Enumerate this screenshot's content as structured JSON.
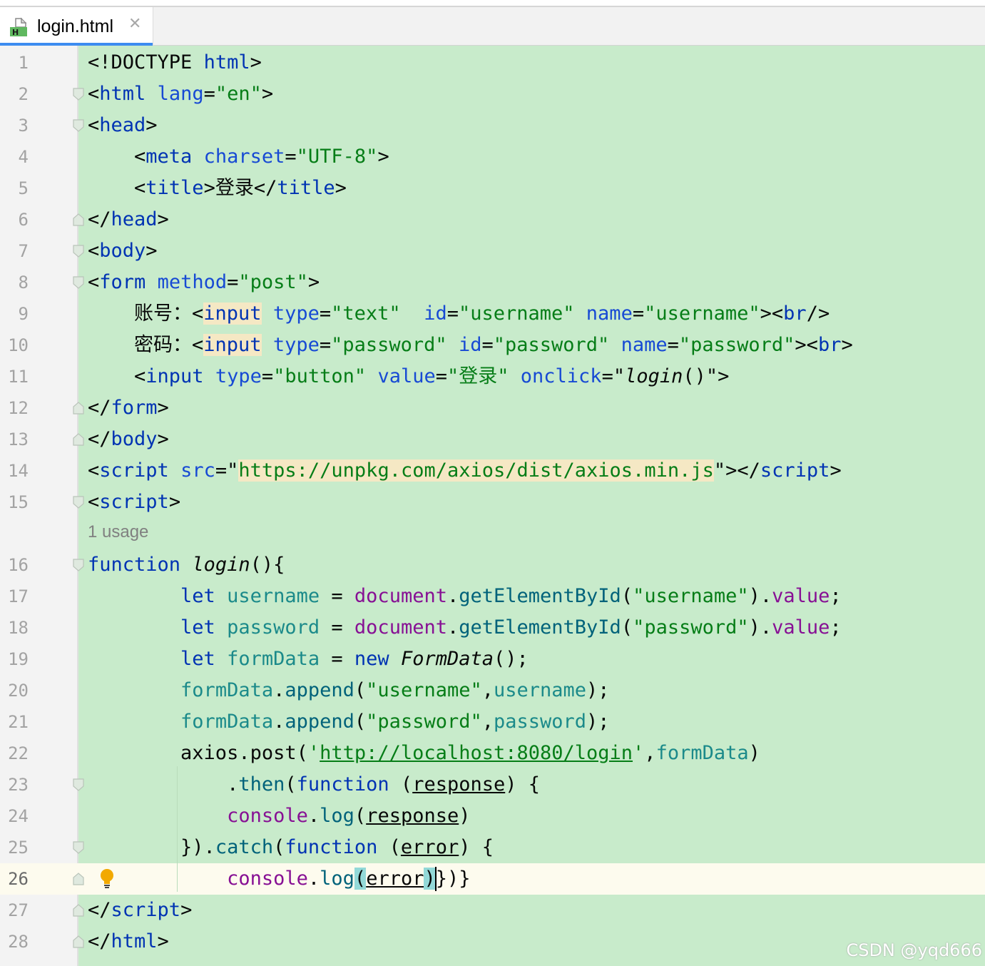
{
  "tab": {
    "label": "login.html",
    "icon": "html-file-icon",
    "close_icon": "close-icon",
    "close_glyph": "✕"
  },
  "editor": {
    "line_numbers": [
      "1",
      "2",
      "3",
      "4",
      "5",
      "6",
      "7",
      "8",
      "9",
      "10",
      "11",
      "12",
      "13",
      "14",
      "15",
      "16",
      "17",
      "18",
      "19",
      "20",
      "21",
      "22",
      "23",
      "24",
      "25",
      "26",
      "27",
      "28"
    ],
    "usage_hint": "1 usage",
    "current_line": "26",
    "intention_icon": "lightbulb-icon",
    "lines": [
      [
        {
          "t": "<!DOCTYPE "
        },
        {
          "t": "html",
          "c": "tag"
        },
        {
          "t": ">"
        }
      ],
      [
        {
          "t": "<"
        },
        {
          "t": "html",
          "c": "tag"
        },
        {
          "t": " "
        },
        {
          "t": "lang",
          "c": "attr"
        },
        {
          "t": "="
        },
        {
          "t": "\"en\"",
          "c": "str"
        },
        {
          "t": ">"
        }
      ],
      [
        {
          "t": "<"
        },
        {
          "t": "head",
          "c": "tag"
        },
        {
          "t": ">"
        }
      ],
      [
        {
          "t": "    <"
        },
        {
          "t": "meta",
          "c": "tag"
        },
        {
          "t": " "
        },
        {
          "t": "charset",
          "c": "attr"
        },
        {
          "t": "="
        },
        {
          "t": "\"UTF-8\"",
          "c": "str"
        },
        {
          "t": ">"
        }
      ],
      [
        {
          "t": "    <"
        },
        {
          "t": "title",
          "c": "tag"
        },
        {
          "t": ">登录</"
        },
        {
          "t": "title",
          "c": "tag"
        },
        {
          "t": ">"
        }
      ],
      [
        {
          "t": "</"
        },
        {
          "t": "head",
          "c": "tag"
        },
        {
          "t": ">"
        }
      ],
      [
        {
          "t": "<"
        },
        {
          "t": "body",
          "c": "tag"
        },
        {
          "t": ">"
        }
      ],
      [
        {
          "t": "<"
        },
        {
          "t": "form",
          "c": "tag"
        },
        {
          "t": " "
        },
        {
          "t": "method",
          "c": "attr"
        },
        {
          "t": "="
        },
        {
          "t": "\"post\"",
          "c": "str"
        },
        {
          "t": ">"
        }
      ],
      [
        {
          "t": "    账号：<"
        },
        {
          "t": "input",
          "c": "tag hlw"
        },
        {
          "t": " "
        },
        {
          "t": "type",
          "c": "attr"
        },
        {
          "t": "="
        },
        {
          "t": "\"text\"",
          "c": "str"
        },
        {
          "t": "  "
        },
        {
          "t": "id",
          "c": "attr"
        },
        {
          "t": "="
        },
        {
          "t": "\"username\"",
          "c": "str"
        },
        {
          "t": " "
        },
        {
          "t": "name",
          "c": "attr"
        },
        {
          "t": "="
        },
        {
          "t": "\"username\"",
          "c": "str"
        },
        {
          "t": "><"
        },
        {
          "t": "br",
          "c": "tag"
        },
        {
          "t": "/>"
        }
      ],
      [
        {
          "t": "    密码：<"
        },
        {
          "t": "input",
          "c": "tag hlw"
        },
        {
          "t": " "
        },
        {
          "t": "type",
          "c": "attr"
        },
        {
          "t": "="
        },
        {
          "t": "\"password\"",
          "c": "str"
        },
        {
          "t": " "
        },
        {
          "t": "id",
          "c": "attr"
        },
        {
          "t": "="
        },
        {
          "t": "\"password\"",
          "c": "str"
        },
        {
          "t": " "
        },
        {
          "t": "name",
          "c": "attr"
        },
        {
          "t": "="
        },
        {
          "t": "\"password\"",
          "c": "str"
        },
        {
          "t": "><"
        },
        {
          "t": "br",
          "c": "tag"
        },
        {
          "t": ">"
        }
      ],
      [
        {
          "t": "    <"
        },
        {
          "t": "input",
          "c": "tag"
        },
        {
          "t": " "
        },
        {
          "t": "type",
          "c": "attr"
        },
        {
          "t": "="
        },
        {
          "t": "\"button\"",
          "c": "str"
        },
        {
          "t": " "
        },
        {
          "t": "value",
          "c": "attr"
        },
        {
          "t": "="
        },
        {
          "t": "\"登录\"",
          "c": "str"
        },
        {
          "t": " "
        },
        {
          "t": "onclick",
          "c": "attr"
        },
        {
          "t": "=\""
        },
        {
          "t": "login",
          "c": "fn"
        },
        {
          "t": "()\">"
        }
      ],
      [
        {
          "t": "</"
        },
        {
          "t": "form",
          "c": "tag"
        },
        {
          "t": ">"
        }
      ],
      [
        {
          "t": "</"
        },
        {
          "t": "body",
          "c": "tag"
        },
        {
          "t": ">"
        }
      ],
      [
        {
          "t": "<"
        },
        {
          "t": "script",
          "c": "tag"
        },
        {
          "t": " "
        },
        {
          "t": "src",
          "c": "attr"
        },
        {
          "t": "=\""
        },
        {
          "t": "https://unpkg.com/axios/dist/axios.min.js",
          "c": "str hlw"
        },
        {
          "t": "\"></"
        },
        {
          "t": "script",
          "c": "tag"
        },
        {
          "t": ">"
        }
      ],
      [
        {
          "t": "<"
        },
        {
          "t": "script",
          "c": "tag"
        },
        {
          "t": ">"
        }
      ],
      [
        {
          "t": "function",
          "c": "kw"
        },
        {
          "t": " "
        },
        {
          "t": "login",
          "c": "fn"
        },
        {
          "t": "(){"
        }
      ],
      [
        {
          "t": "        "
        },
        {
          "t": "let",
          "c": "kw"
        },
        {
          "t": " "
        },
        {
          "t": "username",
          "c": "var"
        },
        {
          "t": " = "
        },
        {
          "t": "document",
          "c": "fld"
        },
        {
          "t": "."
        },
        {
          "t": "getElementById",
          "c": "mth"
        },
        {
          "t": "("
        },
        {
          "t": "\"username\"",
          "c": "str"
        },
        {
          "t": ")."
        },
        {
          "t": "value",
          "c": "fld"
        },
        {
          "t": ";"
        }
      ],
      [
        {
          "t": "        "
        },
        {
          "t": "let",
          "c": "kw"
        },
        {
          "t": " "
        },
        {
          "t": "password",
          "c": "var"
        },
        {
          "t": " = "
        },
        {
          "t": "document",
          "c": "fld"
        },
        {
          "t": "."
        },
        {
          "t": "getElementById",
          "c": "mth"
        },
        {
          "t": "("
        },
        {
          "t": "\"password\"",
          "c": "str"
        },
        {
          "t": ")."
        },
        {
          "t": "value",
          "c": "fld"
        },
        {
          "t": ";"
        }
      ],
      [
        {
          "t": "        "
        },
        {
          "t": "let",
          "c": "kw"
        },
        {
          "t": " "
        },
        {
          "t": "formData",
          "c": "var"
        },
        {
          "t": " = "
        },
        {
          "t": "new",
          "c": "kw"
        },
        {
          "t": " "
        },
        {
          "t": "FormData",
          "c": "fn"
        },
        {
          "t": "();"
        }
      ],
      [
        {
          "t": "        "
        },
        {
          "t": "formData",
          "c": "var"
        },
        {
          "t": "."
        },
        {
          "t": "append",
          "c": "mth"
        },
        {
          "t": "("
        },
        {
          "t": "\"username\"",
          "c": "str"
        },
        {
          "t": ","
        },
        {
          "t": "username",
          "c": "var"
        },
        {
          "t": ");"
        }
      ],
      [
        {
          "t": "        "
        },
        {
          "t": "formData",
          "c": "var"
        },
        {
          "t": "."
        },
        {
          "t": "append",
          "c": "mth"
        },
        {
          "t": "("
        },
        {
          "t": "\"password\"",
          "c": "str"
        },
        {
          "t": ","
        },
        {
          "t": "password",
          "c": "var"
        },
        {
          "t": ");"
        }
      ],
      [
        {
          "t": "        axios.post("
        },
        {
          "t": "'",
          "c": "str"
        },
        {
          "t": "http://localhost:8080/login",
          "c": "str ul"
        },
        {
          "t": "'",
          "c": "str"
        },
        {
          "t": ","
        },
        {
          "t": "formData",
          "c": "var"
        },
        {
          "t": ")"
        }
      ],
      [
        {
          "t": "            ."
        },
        {
          "t": "then",
          "c": "mth"
        },
        {
          "t": "("
        },
        {
          "t": "function",
          "c": "kw"
        },
        {
          "t": " ("
        },
        {
          "t": "response",
          "c": "ul"
        },
        {
          "t": ") {"
        }
      ],
      [
        {
          "t": "            "
        },
        {
          "t": "console",
          "c": "fld"
        },
        {
          "t": "."
        },
        {
          "t": "log",
          "c": "mth"
        },
        {
          "t": "("
        },
        {
          "t": "response",
          "c": "ul"
        },
        {
          "t": ")"
        }
      ],
      [
        {
          "t": "        })."
        },
        {
          "t": "catch",
          "c": "mth"
        },
        {
          "t": "("
        },
        {
          "t": "function",
          "c": "kw"
        },
        {
          "t": " ("
        },
        {
          "t": "error",
          "c": "ul"
        },
        {
          "t": ") {"
        }
      ],
      [
        {
          "t": "            "
        },
        {
          "t": "console",
          "c": "fld"
        },
        {
          "t": "."
        },
        {
          "t": "log",
          "c": "mth"
        },
        {
          "t": "(",
          "c": "brk"
        },
        {
          "t": "error",
          "c": "ul"
        },
        {
          "t": ")",
          "c": "brk"
        },
        {
          "t": "})}"
        }
      ],
      [
        {
          "t": "</"
        },
        {
          "t": "script",
          "c": "tag"
        },
        {
          "t": ">"
        }
      ],
      [
        {
          "t": "</"
        },
        {
          "t": "html",
          "c": "tag"
        },
        {
          "t": ">"
        }
      ]
    ]
  },
  "watermark": "CSDN @yqd666"
}
